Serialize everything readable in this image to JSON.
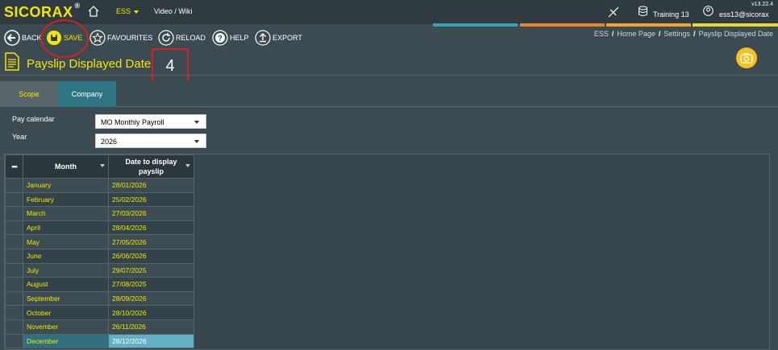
{
  "app": {
    "logo": "SICORAX",
    "registered": "®",
    "version": "v13.22.4"
  },
  "topnav": {
    "ess_label": "ESS",
    "video_label": "Video / Wiki",
    "training_label": "Training 13",
    "user_label": "ess13@sicorax"
  },
  "toolbar": {
    "back": "BACK",
    "save": "SAVE",
    "favourites": "FAVOURITES",
    "reload": "RELOAD",
    "help": "HELP",
    "export": "EXPORT"
  },
  "breadcrumb": [
    "ESS",
    "Home Page",
    "Settings",
    "Payslip Displayed Date"
  ],
  "page": {
    "title": "Payslip Displayed Date",
    "step_number": "4"
  },
  "tabs": [
    {
      "label": "Scope",
      "active": false
    },
    {
      "label": "Company",
      "active": true
    }
  ],
  "form": {
    "pay_calendar_label": "Pay calendar",
    "pay_calendar_value": "MO Monthly Payroll",
    "year_label": "Year",
    "year_value": "2026"
  },
  "grid": {
    "columns": [
      "•••",
      "Month",
      "Date to display payslip"
    ],
    "rows": [
      {
        "month": "January",
        "date": "28/01/2026"
      },
      {
        "month": "February",
        "date": "25/02/2026"
      },
      {
        "month": "March",
        "date": "27/03/2026"
      },
      {
        "month": "April",
        "date": "28/04/2026"
      },
      {
        "month": "May",
        "date": "27/05/2026"
      },
      {
        "month": "June",
        "date": "26/06/2026"
      },
      {
        "month": "July",
        "date": "29/07/2025"
      },
      {
        "month": "August",
        "date": "27/08/2025"
      },
      {
        "month": "September",
        "date": "28/09/2026"
      },
      {
        "month": "October",
        "date": "28/10/2026"
      },
      {
        "month": "November",
        "date": "26/11/2026"
      },
      {
        "month": "December",
        "date": "28/12/2026"
      }
    ],
    "selected_row": 11
  },
  "colors": {
    "accent_yellow": "#f3e600",
    "annotation_red": "#d61f1f",
    "active_tab": "#2f7684",
    "selected_cell": "#63b0c4"
  }
}
